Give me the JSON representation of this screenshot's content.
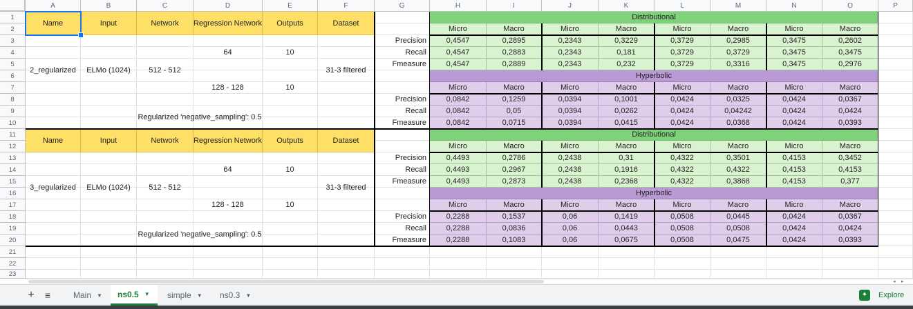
{
  "columns": [
    "A",
    "B",
    "C",
    "D",
    "E",
    "F",
    "G",
    "H",
    "I",
    "J",
    "K",
    "L",
    "M",
    "N",
    "O",
    "P"
  ],
  "rows": [
    "1",
    "2",
    "3",
    "4",
    "5",
    "6",
    "7",
    "8",
    "9",
    "10",
    "11",
    "12",
    "13",
    "14",
    "15",
    "16",
    "17",
    "18",
    "19",
    "20",
    "21",
    "22",
    "23"
  ],
  "colors": {
    "header_yellow": "#ffe066",
    "dist_green": "#d9f2d0",
    "dist_green_header": "#7fd17a",
    "hyp_purple": "#dfcdea",
    "hyp_purple_header": "#b99ad4",
    "accent_green": "#188038"
  },
  "config_headers": [
    "Name",
    "Input",
    "Network",
    "Regression Network",
    "Outputs",
    "Dataset"
  ],
  "blocks": [
    {
      "name": "2_regularized",
      "input": "ELMo (1024)",
      "network": "512 - 512",
      "regression": [
        "64",
        "128 - 128"
      ],
      "outputs": [
        "10",
        "10"
      ],
      "dataset": "31-3 filtered",
      "note": "Regularized 'negative_sampling': 0.5",
      "distributional": {
        "title": "Distributional",
        "subheaders": [
          "Micro",
          "Macro",
          "Micro",
          "Macro",
          "Micro",
          "Macro",
          "Micro",
          "Macro"
        ],
        "metrics": [
          "Precision",
          "Recall",
          "Fmeasure"
        ],
        "values": [
          [
            "0,4547",
            "0,2895",
            "0,2343",
            "0,3229",
            "0,3729",
            "0,2985",
            "0,3475",
            "0,2602"
          ],
          [
            "0,4547",
            "0,2883",
            "0,2343",
            "0,181",
            "0,3729",
            "0,3729",
            "0,3475",
            "0,3475"
          ],
          [
            "0,4547",
            "0,2889",
            "0,2343",
            "0,232",
            "0,3729",
            "0,3316",
            "0,3475",
            "0,2976"
          ]
        ]
      },
      "hyperbolic": {
        "title": "Hyperbolic",
        "subheaders": [
          "Micro",
          "Macro",
          "Micro",
          "Macro",
          "Micro",
          "Macro",
          "Micro",
          "Macro"
        ],
        "metrics": [
          "Precision",
          "Recall",
          "Fmeasure"
        ],
        "values": [
          [
            "0,0842",
            "0,1259",
            "0,0394",
            "0,1001",
            "0,0424",
            "0,0325",
            "0,0424",
            "0,0367"
          ],
          [
            "0,0842",
            "0,05",
            "0,0394",
            "0,0262",
            "0,0424",
            "0,04242",
            "0,0424",
            "0,0424"
          ],
          [
            "0,0842",
            "0,0715",
            "0,0394",
            "0,0415",
            "0,0424",
            "0,0368",
            "0,0424",
            "0,0393"
          ]
        ]
      }
    },
    {
      "name": "3_regularized",
      "input": "ELMo (1024)",
      "network": "512 - 512",
      "regression": [
        "64",
        "128 - 128"
      ],
      "outputs": [
        "10",
        "10"
      ],
      "dataset": "31-3 filtered",
      "note": "Regularized 'negative_sampling': 0.5",
      "distributional": {
        "title": "Distributional",
        "subheaders": [
          "Micro",
          "Macro",
          "Micro",
          "Macro",
          "Micro",
          "Macro",
          "Micro",
          "Macro"
        ],
        "metrics": [
          "Precision",
          "Recall",
          "Fmeasure"
        ],
        "values": [
          [
            "0,4493",
            "0,2786",
            "0,2438",
            "0,31",
            "0,4322",
            "0,3501",
            "0,4153",
            "0,3452"
          ],
          [
            "0,4493",
            "0,2967",
            "0,2438",
            "0,1916",
            "0,4322",
            "0,4322",
            "0,4153",
            "0,4153"
          ],
          [
            "0,4493",
            "0,2873",
            "0,2438",
            "0,2368",
            "0,4322",
            "0,3868",
            "0,4153",
            "0,377"
          ]
        ]
      },
      "hyperbolic": {
        "title": "Hyperbolic",
        "subheaders": [
          "Micro",
          "Macro",
          "Micro",
          "Macro",
          "Micro",
          "Macro",
          "Micro",
          "Macro"
        ],
        "metrics": [
          "Precision",
          "Recall",
          "Fmeasure"
        ],
        "values": [
          [
            "0,2288",
            "0,1537",
            "0,06",
            "0,1419",
            "0,0508",
            "0,0445",
            "0,0424",
            "0,0367"
          ],
          [
            "0,2288",
            "0,0836",
            "0,06",
            "0,0443",
            "0,0508",
            "0,0508",
            "0,0424",
            "0,0424"
          ],
          [
            "0,2288",
            "0,1083",
            "0,06",
            "0,0675",
            "0,0508",
            "0,0475",
            "0,0424",
            "0,0393"
          ]
        ]
      }
    }
  ],
  "tabs": {
    "add_icon": "plus-icon",
    "list_icon": "menu-list-icon",
    "items": [
      {
        "label": "Main",
        "active": false
      },
      {
        "label": "ns0.5",
        "active": true
      },
      {
        "label": "simple",
        "active": false
      },
      {
        "label": "ns0.3",
        "active": false
      }
    ]
  },
  "explore": {
    "label": "Explore",
    "icon": "explore-icon"
  }
}
